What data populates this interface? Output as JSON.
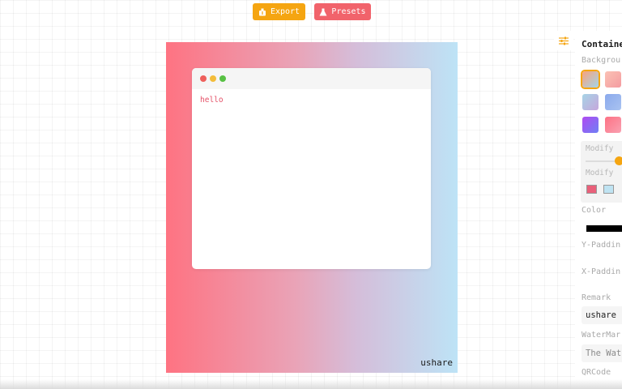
{
  "toolbar": {
    "export_label": "Export",
    "presets_label": "Presets",
    "export_color": "#f5a511",
    "presets_color": "#f1636b"
  },
  "canvas": {
    "gradient": [
      "#fe7382",
      "#bde3f6"
    ],
    "code_text": "hello",
    "remark": "ushare"
  },
  "panel": {
    "title": "Containe",
    "background_label": "Backgrou",
    "modify_label_1": "Modify",
    "modify_label_2": "Modify",
    "color_label": "Color",
    "color_value": "#000000",
    "y_padding_label": "Y-Paddin",
    "x_padding_label": "X-Paddin",
    "remark_label": "Remark",
    "remark_value": "ushare",
    "watermark_label": "WaterMar",
    "watermark_placeholder": "The Wat",
    "qrcode_label": "QRCode",
    "swatches": [
      "#f6a37f",
      "#f9b7b0",
      "#a6d4e6",
      "#8aa9ec",
      "#9a56f0",
      "#fd7184"
    ],
    "mini_swatches": [
      "#e9607a",
      "#bfe3f2"
    ]
  }
}
